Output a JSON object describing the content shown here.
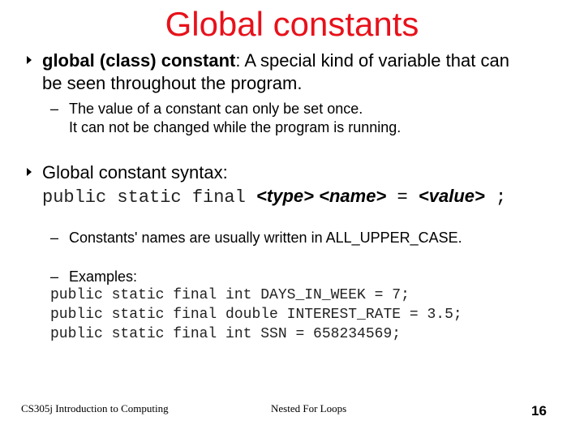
{
  "slide": {
    "title": "Global constants",
    "bullets": [
      {
        "term": "global (class) constant",
        "text": ": A special kind of variable that can",
        "text_line2": "be seen throughout the program.",
        "subpoints": [
          "The value of a constant can only be set once.",
          "It can not be changed while the program is running."
        ]
      },
      {
        "label": "Global constant syntax:",
        "syntax": {
          "keywords": "public static final ",
          "type": "<type>",
          "name": "<name>",
          "equals": " = ",
          "value": "<value>",
          "semicolon": " ;"
        },
        "subpoints": [
          "Constants' names are usually written in ALL_UPPER_CASE.",
          "Examples:"
        ],
        "examples": [
          "public static final int DAYS_IN_WEEK = 7;",
          "public static final double INTEREST_RATE = 3.5;",
          "public static final int SSN = 658234569;"
        ]
      }
    ],
    "dash": "–"
  },
  "footer": {
    "course": "CS305j Introduction to Computing",
    "topic": "Nested For Loops",
    "page_number": "16"
  }
}
